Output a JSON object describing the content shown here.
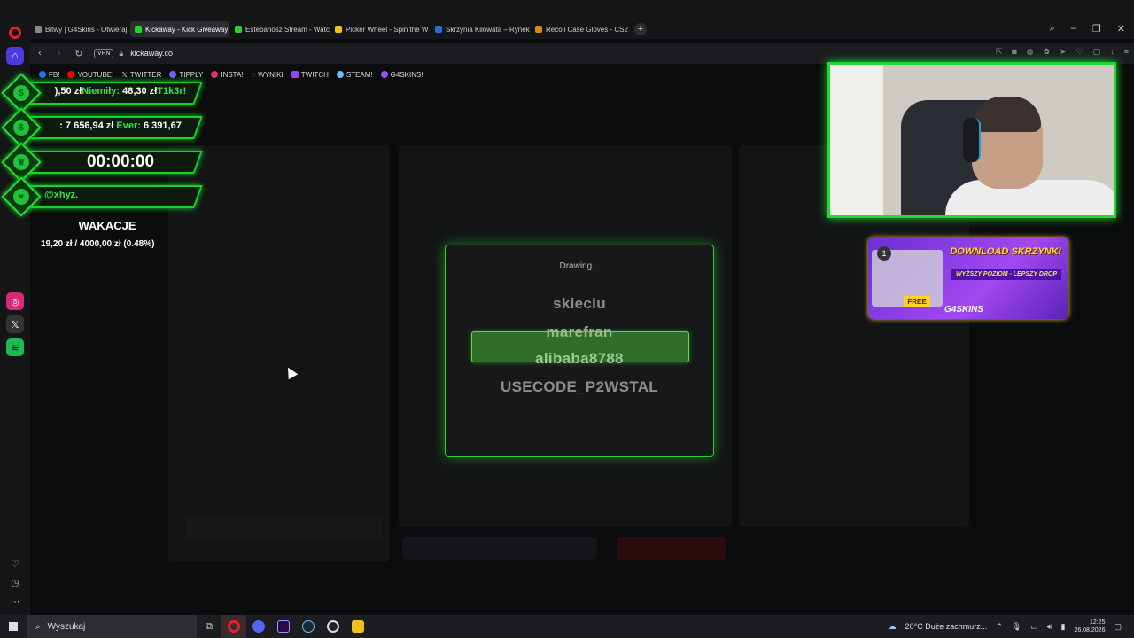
{
  "browser": {
    "tabs": [
      {
        "label": "Bitwy | G4Skins - Otwieraj",
        "color": "#888888",
        "active": false
      },
      {
        "label": "Kickaway - Kick Giveaway",
        "color": "#2bd12b",
        "active": true
      },
      {
        "label": "Estebanosz Stream - Watch",
        "color": "#2bd12b",
        "active": false
      },
      {
        "label": "Picker Wheel - Spin the W",
        "color": "#f2c21b",
        "active": false
      },
      {
        "label": "Skrzynia Kilowata – Rynek",
        "color": "#2b6cd1",
        "active": false
      },
      {
        "label": "Recoil Case Gloves - CS2",
        "color": "#e0851a",
        "active": false
      }
    ],
    "vpn_label": "VPN",
    "url": "kickaway.co",
    "bookmarks": [
      {
        "label": "FB!",
        "color": "#1877f2"
      },
      {
        "label": "YOUTUBE!",
        "color": "#ff0000"
      },
      {
        "label": "TWITTER",
        "color": "#ffffff"
      },
      {
        "label": "TIPPLY",
        "color": "#7c5cff"
      },
      {
        "label": "INSTA!",
        "color": "#e1306c"
      },
      {
        "label": "WYNIKI",
        "color": "#cccccc"
      },
      {
        "label": "TWITCH",
        "color": "#9146ff"
      },
      {
        "label": "STEAM!",
        "color": "#66c0f4"
      },
      {
        "label": "G4SKINS!",
        "color": "#a24cff"
      }
    ]
  },
  "overlay": {
    "donations_text_a": "),50 zł",
    "donations_name_a": "Niemiły:",
    "donations_value_a": " 48,30 zł",
    "donations_name_b": "T1k3r!",
    "ranking_text": ": 7 656,94 zł ",
    "ranking_name": "Ever:",
    "ranking_value": " 6 391,67",
    "timer": "00:00:00",
    "follower": "@xhyz.",
    "goal_title": "WAKACJE",
    "goal_progress": "19,20 zł  /  4000,00 zł",
    "goal_percent": "(0.48%)",
    "goal_fraction": 0.0048
  },
  "modal": {
    "title": "Drawing...",
    "entries": [
      "skieciu",
      "marefran",
      "alibaba8788",
      "USECODE_P2WSTAL"
    ],
    "selected_index": 2
  },
  "ad": {
    "badge": "1",
    "title": "DOWNLOAD SKRZYNKI",
    "subtitle": "WYŻSZY POZIOM - LEPSZY DROP",
    "free": "FREE",
    "brand": "G4SKINS"
  },
  "taskbar": {
    "search_placeholder": "Wyszukaj",
    "weather": "20°C  Duże zachmurz...",
    "time": "12:25",
    "date": "26.08.2026"
  }
}
